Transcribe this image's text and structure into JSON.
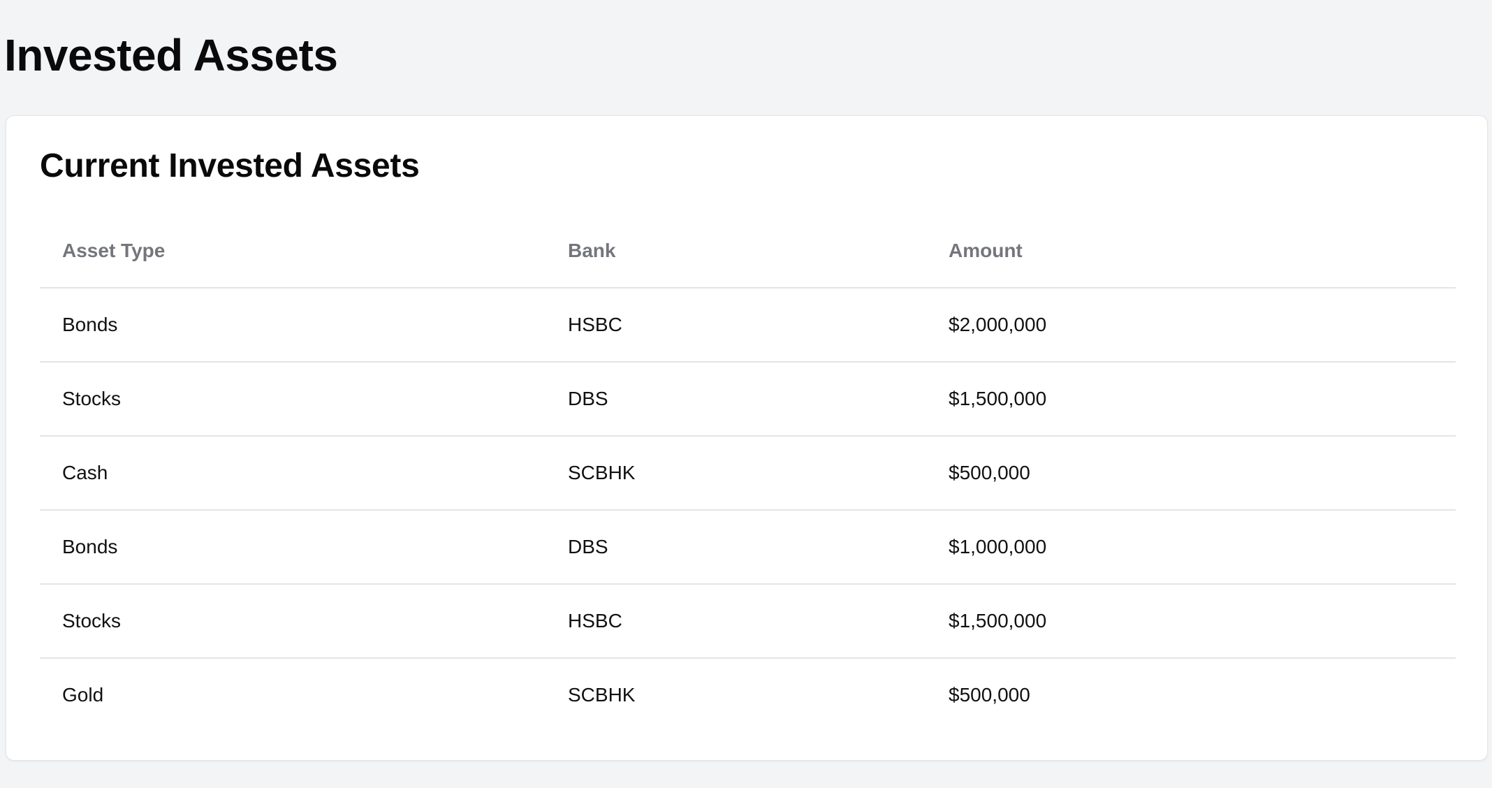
{
  "page": {
    "title": "Invested Assets"
  },
  "card": {
    "title": "Current Invested Assets"
  },
  "table": {
    "headers": {
      "asset_type": "Asset Type",
      "bank": "Bank",
      "amount": "Amount"
    },
    "rows": [
      {
        "asset_type": "Bonds",
        "bank": "HSBC",
        "amount": "$2,000,000"
      },
      {
        "asset_type": "Stocks",
        "bank": "DBS",
        "amount": "$1,500,000"
      },
      {
        "asset_type": "Cash",
        "bank": "SCBHK",
        "amount": "$500,000"
      },
      {
        "asset_type": "Bonds",
        "bank": "DBS",
        "amount": "$1,000,000"
      },
      {
        "asset_type": "Stocks",
        "bank": "HSBC",
        "amount": "$1,500,000"
      },
      {
        "asset_type": "Gold",
        "bank": "SCBHK",
        "amount": "$500,000"
      }
    ]
  },
  "colors": {
    "background": "#f3f4f6",
    "card": "#ffffff",
    "header_text": "#74767c",
    "body_text": "#111111",
    "divider": "#e2e4e7"
  }
}
